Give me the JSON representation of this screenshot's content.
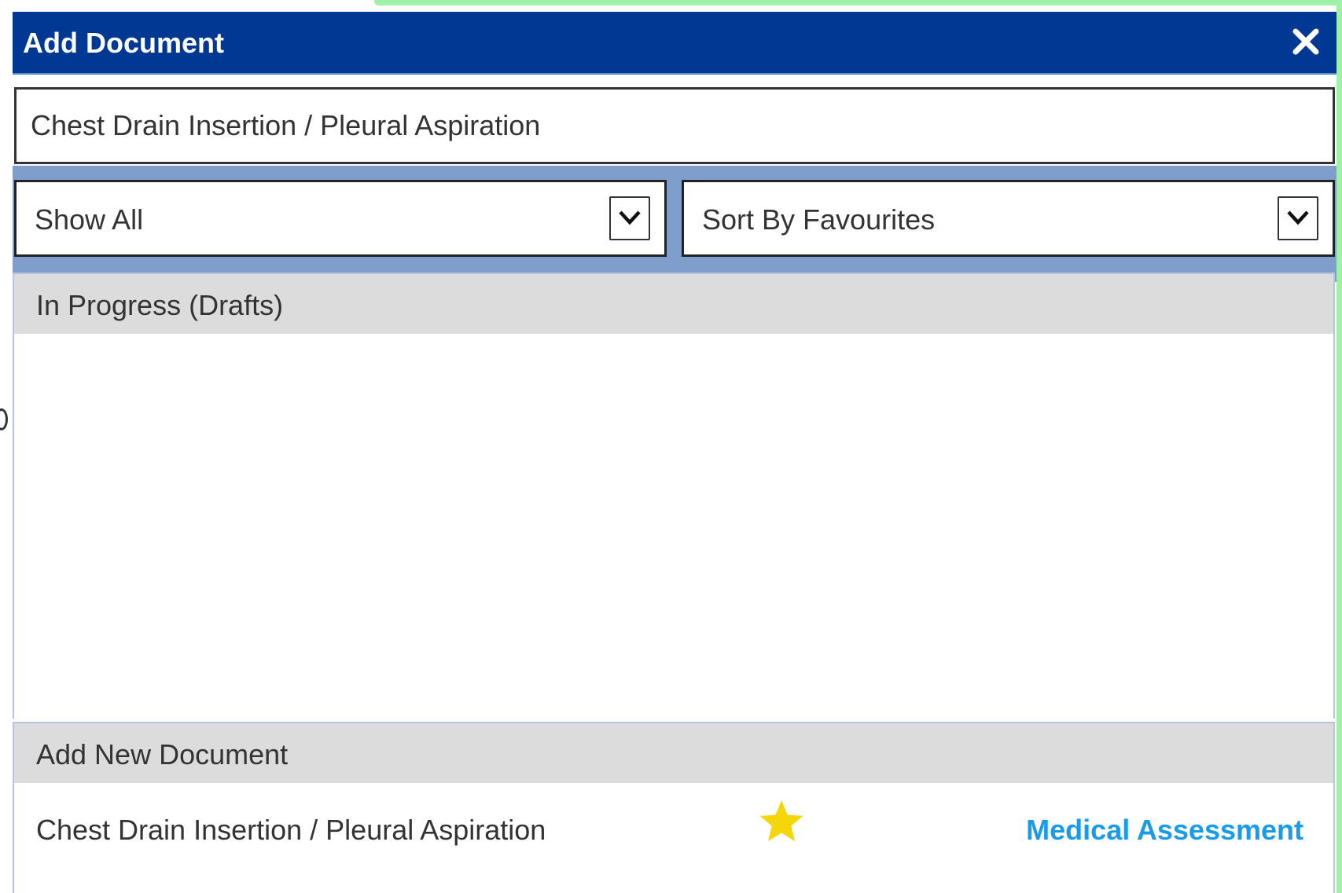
{
  "dialog": {
    "title": "Add Document",
    "close_icon": "close-icon"
  },
  "search": {
    "value": "Chest Drain Insertion / Pleural Aspiration",
    "placeholder": ""
  },
  "filters": {
    "show": {
      "selected": "Show All",
      "icon": "chevron-down-icon"
    },
    "sort": {
      "selected": "Sort By Favourites",
      "icon": "chevron-down-icon"
    }
  },
  "sections": {
    "drafts": {
      "label": "In Progress (Drafts)",
      "items": []
    },
    "new_document": {
      "label": "Add New Document",
      "items": [
        {
          "name": "Chest Drain Insertion / Pleural Aspiration",
          "favourite": true,
          "favourite_icon": "star-icon",
          "category": "Medical Assessment"
        }
      ]
    }
  },
  "colors": {
    "titlebar": "#003893",
    "filter_band": "#7f9ecc",
    "section_header": "#dcdcdc",
    "category_link": "#1a9be8",
    "star": "#f5d60a",
    "window_accent": "#9ff0a8"
  }
}
